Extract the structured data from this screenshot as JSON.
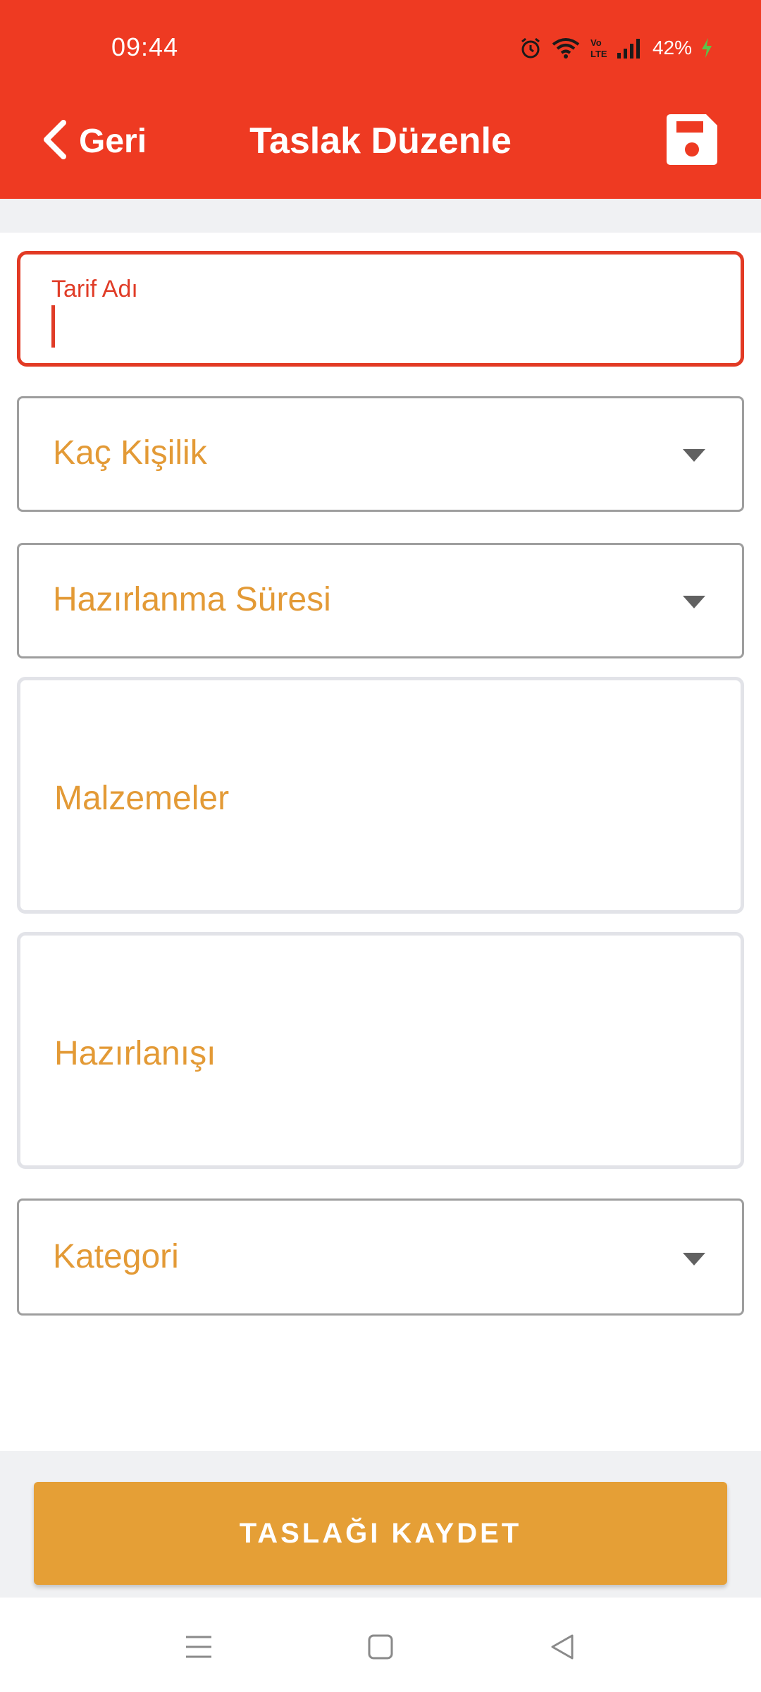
{
  "status_bar": {
    "time": "09:44",
    "battery": "42%",
    "icons": [
      "alarm-icon",
      "wifi-icon",
      "volte-icon",
      "signal-icon",
      "charging-icon"
    ]
  },
  "header": {
    "back_label": "Geri",
    "title": "Taslak Düzenle",
    "save_icon": "save-icon",
    "background_color": "#ee3a22"
  },
  "form": {
    "recipe_name": {
      "label": "Tarif Adı",
      "value": ""
    },
    "servings": {
      "placeholder": "Kaç Kişilik"
    },
    "prep_time": {
      "placeholder": "Hazırlanma Süresi"
    },
    "ingredients": {
      "placeholder": "Malzemeler"
    },
    "preparation": {
      "placeholder": "Hazırlanışı"
    },
    "category": {
      "placeholder": "Kategori"
    }
  },
  "actions": {
    "save_draft_label": "TASLAĞI KAYDET",
    "button_color": "#e59f36"
  },
  "nav_bar": {
    "icons": [
      "menu-icon",
      "home-icon",
      "back-icon"
    ]
  }
}
